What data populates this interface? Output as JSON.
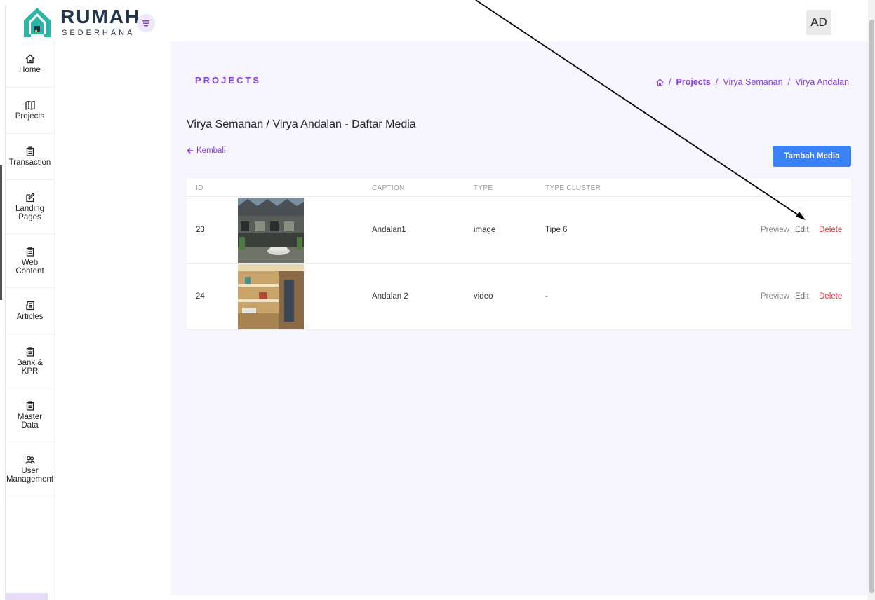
{
  "brand": {
    "name": "RUMAH",
    "tagline": "SEDERHANA"
  },
  "user": {
    "initials": "AD"
  },
  "sidebar": {
    "items": [
      {
        "label": "Home",
        "icon": "home-icon"
      },
      {
        "label": "Projects",
        "icon": "map-icon"
      },
      {
        "label": "Transaction",
        "icon": "clipboard-icon"
      },
      {
        "label": "Landing\nPages",
        "icon": "edit-icon"
      },
      {
        "label": "Web\nContent",
        "icon": "clipboard-icon"
      },
      {
        "label": "Articles",
        "icon": "newspaper-icon"
      },
      {
        "label": "Bank &\nKPR",
        "icon": "clipboard-icon"
      },
      {
        "label": "Master\nData",
        "icon": "clipboard-icon"
      },
      {
        "label": "User\nManagement",
        "icon": "users-icon"
      }
    ]
  },
  "header": {
    "title": "PROJECTS"
  },
  "breadcrumb": {
    "sep": "/",
    "items": [
      "Projects",
      "Virya Semanan",
      "Virya Andalan"
    ]
  },
  "section": {
    "title": "Virya Semanan / Virya Andalan - Daftar Media"
  },
  "back_label": "Kembali",
  "add_button": "Tambah Media",
  "table": {
    "columns": [
      "ID",
      "CAPTION",
      "TYPE",
      "TYPE CLUSTER"
    ],
    "rows": [
      {
        "id": "23",
        "caption": "Andalan1",
        "type": "image",
        "cluster": "Tipe 6"
      },
      {
        "id": "24",
        "caption": "Andalan 2",
        "type": "video",
        "cluster": "-"
      }
    ],
    "actions": {
      "preview": "Preview",
      "edit": "Edit",
      "delete": "Delete"
    }
  },
  "colors": {
    "accent": "#8a3ee0",
    "primary_button": "#3b82f6",
    "danger": "#e0303a",
    "content_bg": "#f6f4fc"
  }
}
